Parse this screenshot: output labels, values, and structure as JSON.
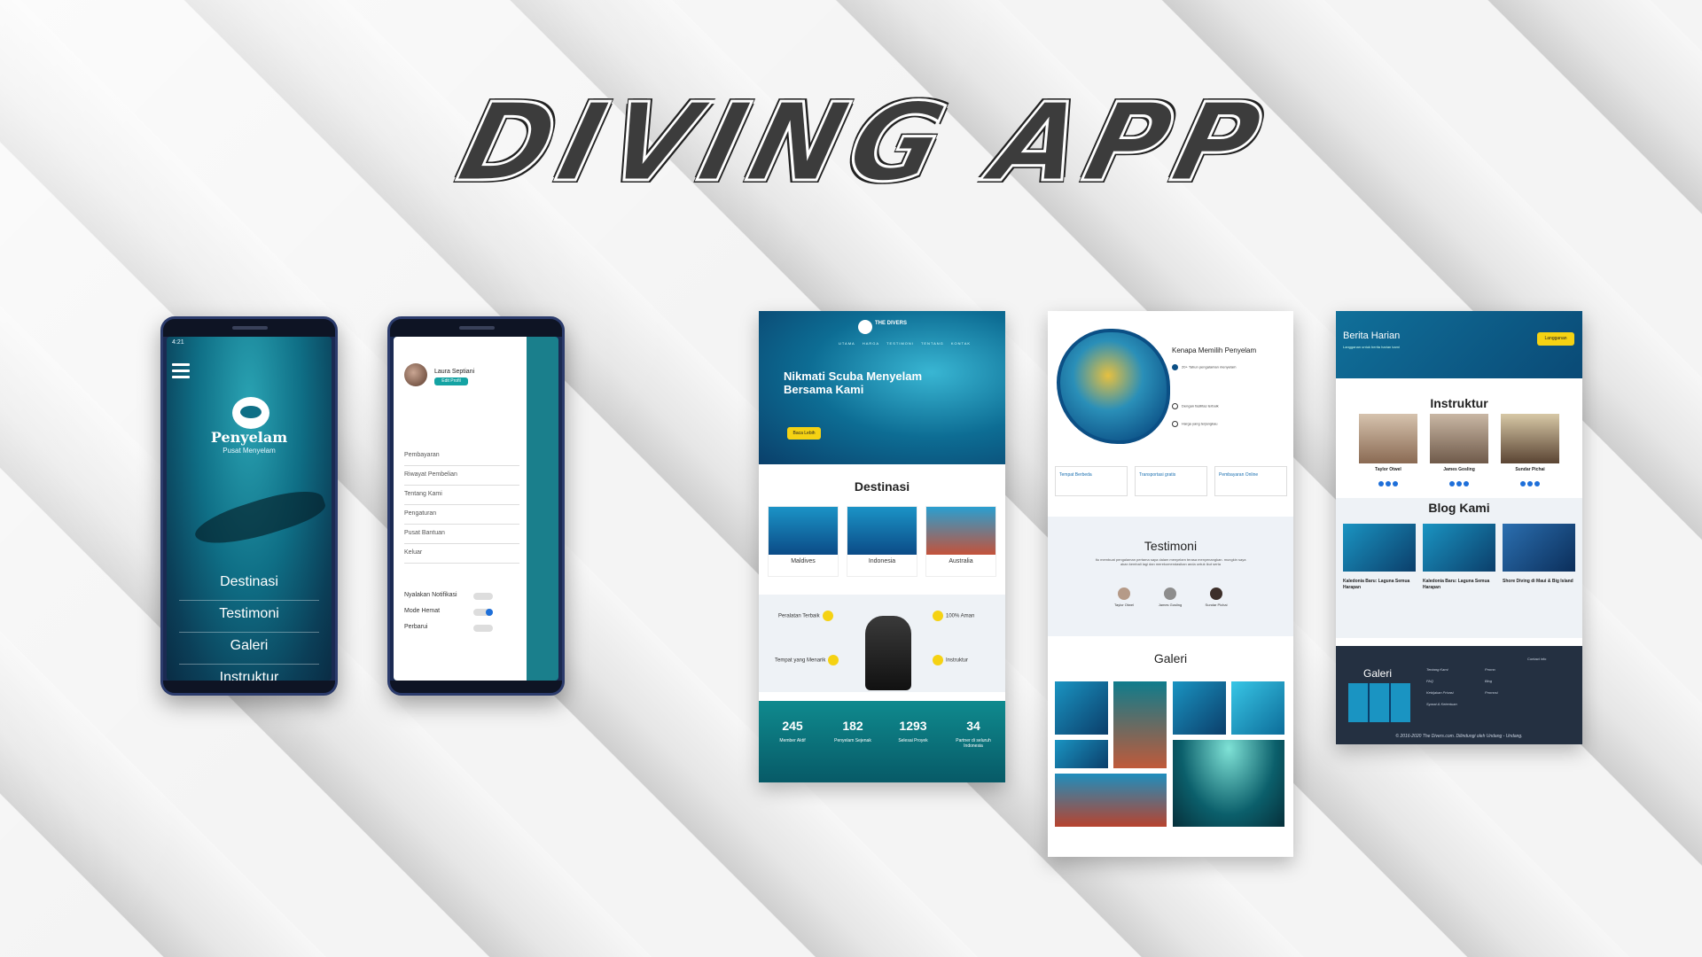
{
  "title": "DIVING APP",
  "phone1": {
    "status_time": "4:21",
    "brand": "Penyelam",
    "brand_sub": "Pusat Menyelam",
    "menu": [
      "Destinasi",
      "Testimoni",
      "Galeri",
      "Instruktur"
    ]
  },
  "phone2": {
    "user_name": "Laura Septiani",
    "edit_label": "Edit Profil",
    "menu": [
      "Pembayaran",
      "Riwayat Pembelian",
      "Tentang Kami",
      "Pengaturan",
      "Pusat Bantuan",
      "Keluar"
    ],
    "toggles": [
      {
        "label": "Nyalakan Notifikasi",
        "on": false
      },
      {
        "label": "Mode Hemat",
        "on": true
      },
      {
        "label": "Perbarui",
        "on": false
      }
    ]
  },
  "panel1": {
    "brand": "THE DIVERS",
    "nav": [
      "UTAMA",
      "HARGA",
      "TESTIMONI",
      "TENTANG",
      "KONTAK"
    ],
    "hero_title": "Nikmati Scuba Menyelam Bersama Kami",
    "cta": "Baca Lebih",
    "destinasi_title": "Destinasi",
    "destinations": [
      "Maldives",
      "Indonesia",
      "Australia"
    ],
    "features": [
      "Peralatan Terbaik",
      "100% Aman",
      "Tempat yang Menarik",
      "Instruktur"
    ],
    "stats": [
      {
        "num": "245",
        "label": "Member Aktif"
      },
      {
        "num": "182",
        "label": "Penyelam Sejenak"
      },
      {
        "num": "1293",
        "label": "Selesai Proyek"
      },
      {
        "num": "34",
        "label": "Partner di seluruh Indonesia"
      }
    ]
  },
  "panel2": {
    "why_title": "Kenapa Memilih Penyelam",
    "why_items": [
      "20+ Tahun pengalaman menyelam",
      "Dengan fasilitas terbaik",
      "Harga yang terjangkau"
    ],
    "boxes": [
      "Tempat Berbeda",
      "Transportasi gratis",
      "Pembayaran Online"
    ],
    "testimoni_title": "Testimoni",
    "testimoni_text": "Itu membuat pengalaman pertama saya dalam menyelam terasa menyenangkan. mungkin saya akan kembali lagi dan merekomendasikan anda untuk ikut serta",
    "people": [
      "Taylor Otwel",
      "James Gosling",
      "Sundar Pichai"
    ],
    "galeri_title": "Galeri"
  },
  "panel3": {
    "hero_title": "Berita Harian",
    "hero_sub": "Langganan untuk berita harian kami",
    "hero_btn": "Langganan",
    "instruktur_title": "Instruktur",
    "instructors": [
      "Taylor Otwel",
      "James Gosling",
      "Sundar Pichai"
    ],
    "blog_title": "Blog Kami",
    "posts": [
      "Kaledonia Baru: Laguna Semua Harapan",
      "Kaledonia Baru: Laguna Semua Harapan",
      "Shore Diving di Maui & Big Island"
    ],
    "footer_title": "Galeri",
    "footer_col1": [
      "Tentang Kami",
      "FAQ",
      "Kebijakan Privasi",
      "Syarat & Ketentuan"
    ],
    "footer_col2": [
      "Promo",
      "Blog",
      "Promosi"
    ],
    "contact_title": "Contact info",
    "copyright": "© 2016-2020 The Divers.com. Dilindungi oleh Undang - Undang."
  }
}
